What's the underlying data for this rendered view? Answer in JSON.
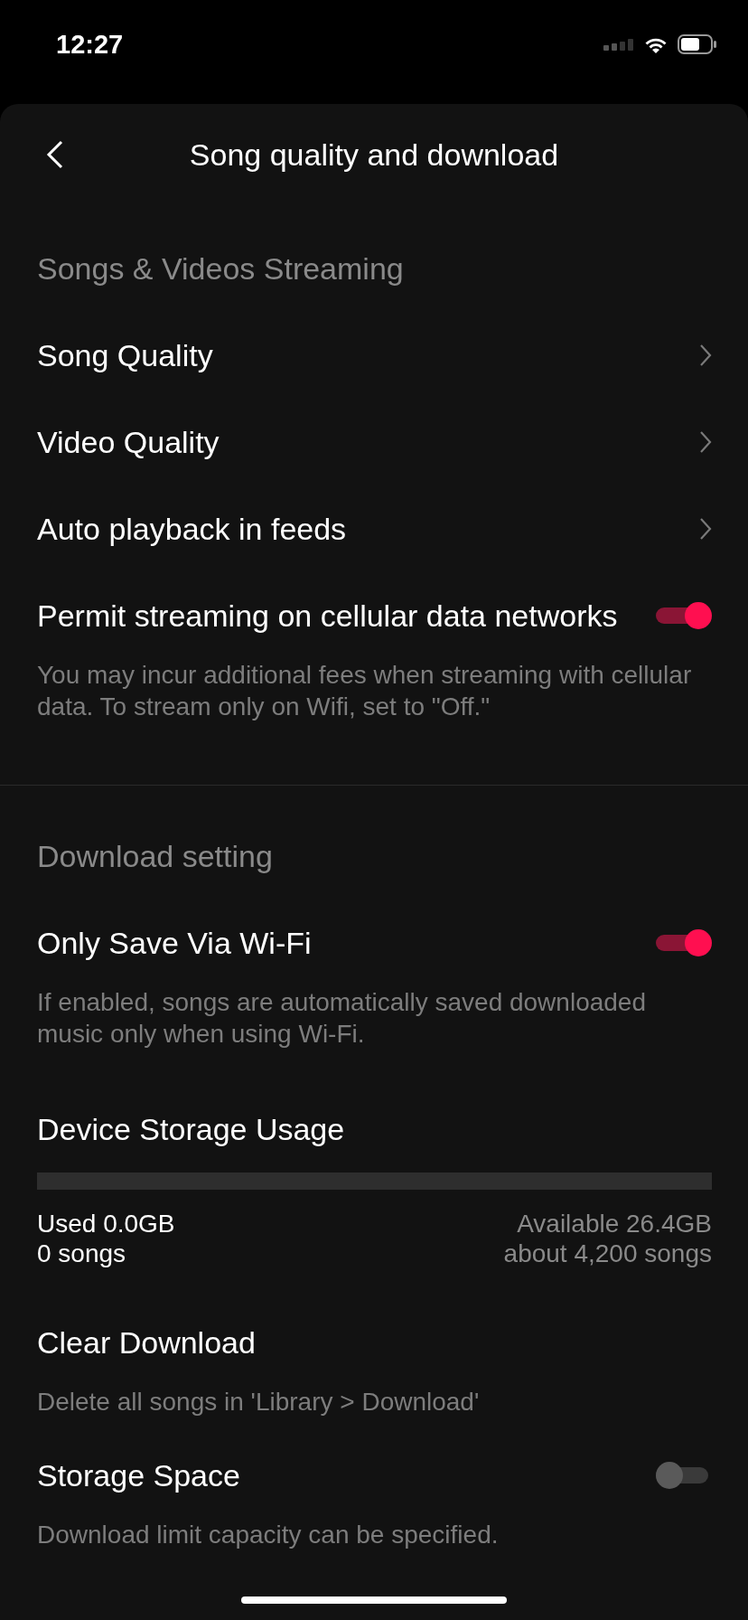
{
  "status_bar": {
    "time": "12:27"
  },
  "header": {
    "title": "Song quality and download"
  },
  "sections": [
    {
      "title": "Songs & Videos Streaming",
      "items": [
        {
          "kind": "link",
          "label": "Song Quality"
        },
        {
          "kind": "link",
          "label": "Video Quality"
        },
        {
          "kind": "link",
          "label": "Auto playback in feeds"
        },
        {
          "kind": "toggle",
          "label": "Permit streaming on cellular data networks",
          "on": true,
          "note": "You may incur additional fees when streaming with cellular data. To stream only on Wifi, set to \"Off.\""
        }
      ]
    },
    {
      "title": "Download setting",
      "items": [
        {
          "kind": "toggle",
          "label": "Only Save Via Wi-Fi",
          "on": true,
          "note": "If enabled, songs are automatically saved downloaded music only when using Wi-Fi."
        },
        {
          "kind": "storage",
          "label": "Device Storage Usage",
          "level": 0,
          "used": "Used 0.0GB",
          "used_songs": "0 songs",
          "available": "Available 26.4GB",
          "available_songs": "about 4,200 songs"
        },
        {
          "kind": "action",
          "label": "Clear Download",
          "note": "Delete all songs in 'Library > Download'"
        },
        {
          "kind": "toggle",
          "label": "Storage Space",
          "on": false,
          "note": "Download limit capacity can be specified."
        }
      ]
    }
  ]
}
